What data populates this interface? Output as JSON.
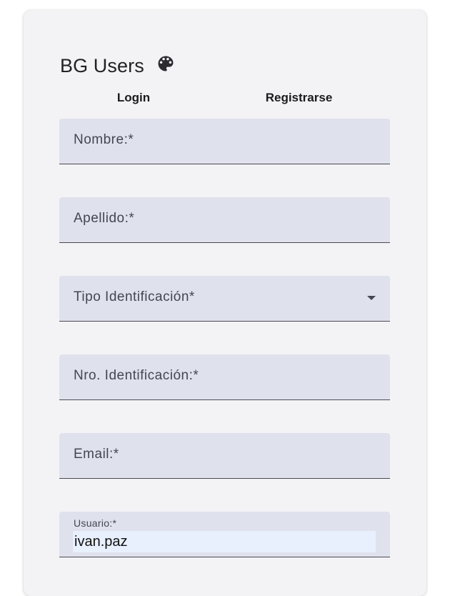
{
  "app": {
    "title": "BG Users",
    "icon": "palette-icon"
  },
  "tabs": [
    {
      "label": "Login",
      "active": false
    },
    {
      "label": "Registrarse",
      "active": true
    }
  ],
  "form": {
    "nombre": {
      "label": "Nombre:*",
      "value": ""
    },
    "apellido": {
      "label": "Apellido:*",
      "value": ""
    },
    "tipo_identificacion": {
      "label": "Tipo Identificación*",
      "value": "",
      "icon": "chevron-down-icon"
    },
    "nro_identificacion": {
      "label": "Nro. Identificación:*",
      "value": ""
    },
    "email": {
      "label": "Email:*",
      "value": ""
    },
    "usuario": {
      "label": "Usuario:*",
      "value": "ivan.paz"
    }
  },
  "colors": {
    "card_bg": "#f3f3f6",
    "field_bg": "#dfe1ec",
    "autofill_bg": "#e8f0fe",
    "tab_indicator": "#2f6aa8"
  }
}
